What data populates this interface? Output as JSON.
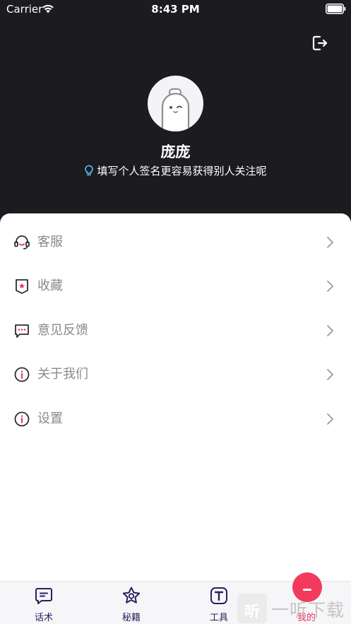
{
  "status_bar": {
    "carrier": "Carrier",
    "time": "8:43 PM"
  },
  "profile": {
    "name": "庞庞",
    "signature": "填写个人签名更容易获得别人关注呢"
  },
  "menu": [
    {
      "label": "客服",
      "icon": "headset-icon"
    },
    {
      "label": "收藏",
      "icon": "bookmark-star-icon"
    },
    {
      "label": "意见反馈",
      "icon": "chat-bubble-icon"
    },
    {
      "label": "关于我们",
      "icon": "info-icon"
    },
    {
      "label": "设置",
      "icon": "info-icon"
    }
  ],
  "tabs": [
    {
      "label": "话术",
      "icon": "message-icon",
      "active": false
    },
    {
      "label": "秘籍",
      "icon": "star-icon",
      "active": false
    },
    {
      "label": "工具",
      "icon": "text-tool-icon",
      "active": false
    },
    {
      "label": "我的",
      "icon": "profile-icon",
      "active": true
    }
  ],
  "watermark": {
    "badge": "听",
    "text": "一听下载"
  },
  "colors": {
    "header_bg": "#1c1b20",
    "accent": "#e8345a",
    "tab_text": "#2a1f5e",
    "menu_text": "#8a8a8e"
  }
}
